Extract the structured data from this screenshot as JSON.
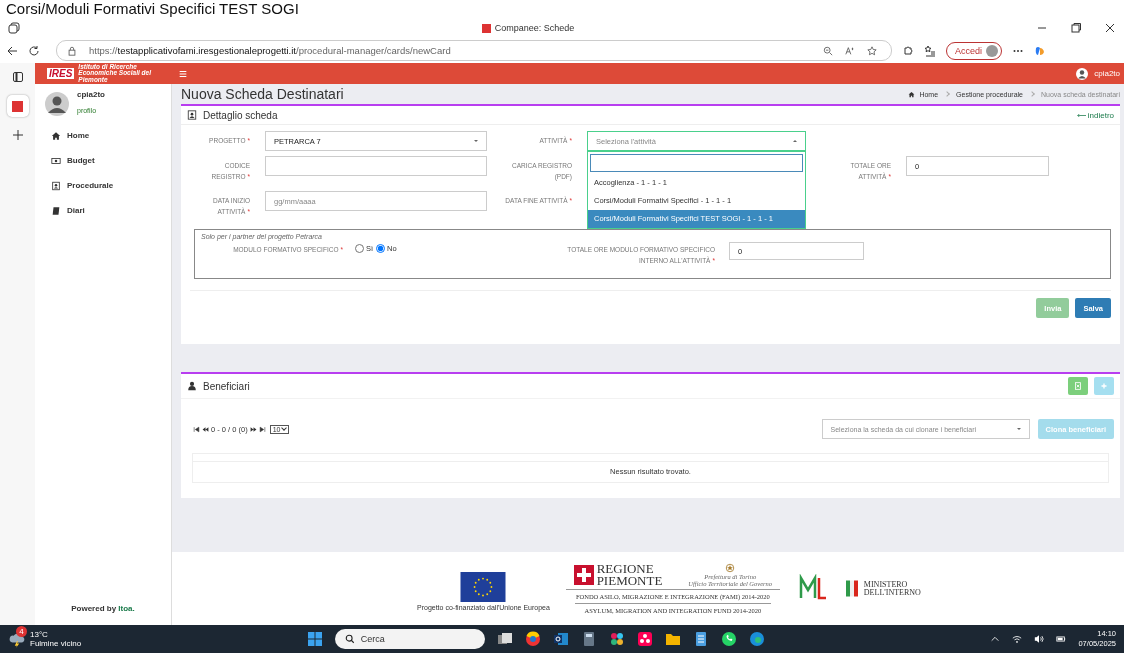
{
  "caption": "Corsi/Moduli Formativi Specifici TEST SOGI",
  "browser": {
    "tab_title": "Companee: Schede",
    "url_scheme": "https://",
    "url_host": "testapplicativofami.iresgestionaleprogetti.it",
    "url_path": "/procedural-manager/cards/newCard",
    "account_button": "Accedi"
  },
  "header": {
    "logo_mark": "IRES",
    "logo_text": "Istituto di Ricerche Economiche Sociali del Piemonte",
    "user": "cpia2to"
  },
  "sidebar": {
    "user": "cpia2to",
    "profile_link": "profilo",
    "items": [
      {
        "label": "Home"
      },
      {
        "label": "Budget"
      },
      {
        "label": "Procedurale"
      },
      {
        "label": "Diari"
      }
    ],
    "powered_by": "Powered by",
    "powered_link": "Itoa."
  },
  "page": {
    "title": "Nuova Scheda Destinatari",
    "breadcrumbs": [
      "Home",
      "Gestione procedurale",
      "Nuova scheda destinatari"
    ]
  },
  "detail_card": {
    "title": "Dettaglio scheda",
    "back_link": "indietro",
    "required_mark": "*",
    "fields": [
      {
        "label": "PROGETTO",
        "required": true,
        "kind": "select",
        "value": "PETRARCA 7"
      },
      {
        "label": "ATTIVITÀ",
        "required": true,
        "kind": "select_open",
        "placeholder": "Seleziona l'attività"
      },
      {
        "label": "CODICE REGISTRO",
        "required": true,
        "kind": "input"
      },
      {
        "label": "CARICA REGISTRO (PDF)",
        "required": false,
        "kind": "covered"
      },
      {
        "label": "TOTALE ORE ATTIVITÀ",
        "required": true,
        "kind": "input",
        "value": "0"
      },
      {
        "label": "DATA INIZIO ATTIVITÀ",
        "required": true,
        "kind": "input",
        "placeholder": "gg/mm/aaaa"
      },
      {
        "label": "DATA FINE ATTIVITÀ",
        "required": true,
        "kind": "covered"
      }
    ],
    "dropdown_options": [
      {
        "label": "Accoglienza - 1 - 1 - 1",
        "selected": false
      },
      {
        "label": "Corsi/Moduli Formativi Specifici - 1 - 1 - 1",
        "selected": false
      },
      {
        "label": "Corsi/Moduli Formativi Specifici TEST SOGI - 1 - 1 - 1",
        "selected": true
      }
    ],
    "petrarca": {
      "note": "Solo per i partner del progetto Petrarca",
      "module_label": "MODULO FORMATIVO SPECIFICO",
      "options": [
        {
          "label": "Sì",
          "selected": false
        },
        {
          "label": "No",
          "selected": true
        }
      ],
      "hours_label": "TOTALE ORE MODULO FORMATIVO SPECIFICO INTERNO ALL'ATTIVITÀ",
      "hours_value": "0"
    },
    "buttons": [
      {
        "label": "Invia",
        "kind": "success",
        "disabled": true
      },
      {
        "label": "Salva",
        "kind": "primary",
        "disabled": false
      }
    ]
  },
  "beneficiari": {
    "title": "Beneficiari",
    "pager": "0 - 0 / 0 (0)",
    "page_size": "10",
    "clone_placeholder": "Seleziona la scheda da cui clonare i beneficiari",
    "clone_button": "Clona beneficiari",
    "empty": "Nessun risultato trovato."
  },
  "footer": {
    "eu_caption": "Progetto co-finanziato dall'Unione Europea",
    "region": [
      "REGIONE",
      "PIEMONTE"
    ],
    "prefettura": [
      "Prefettura di Torino",
      "Ufficio Territoriale del Governo"
    ],
    "ministero": [
      "MINISTERO",
      "DELL'INTERNO"
    ],
    "fund_it": "FONDO ASILO, MIGRAZIONE E INTEGRAZIONE (FAMI) 2014-2020",
    "fund_en": "ASYLUM, MIGRATION AND INTEGRATION FUND 2014-2020"
  },
  "taskbar": {
    "weather_badge": "4",
    "temperature": "13°C",
    "weather": "Fulmine vicino",
    "search": "Cerca",
    "time": "14:10",
    "date": "07/05/2025"
  }
}
